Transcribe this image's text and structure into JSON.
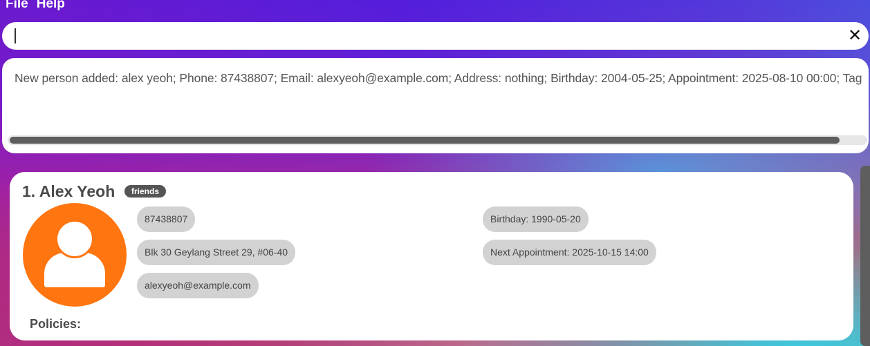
{
  "menu": {
    "file": "File",
    "help": "Help"
  },
  "command": {
    "value": "",
    "clear_icon": "close-icon"
  },
  "result": {
    "message": "New person added: alex yeoh; Phone: 87438807; Email: alexyeoh@example.com; Address: nothing; Birthday: 2004-05-25; Appointment: 2025-08-10 00:00; Tag"
  },
  "person": {
    "name": "1. Alex Yeoh",
    "tag": "friends",
    "phone": "87438807",
    "address": "Blk 30 Geylang Street 29, #06-40",
    "email": "alexyeoh@example.com",
    "birthday": "Birthday: 1990-05-20",
    "appointment": "Next Appointment: 2025-10-15 14:00",
    "policies_label": "Policies:",
    "avatar_color": "#ff7510"
  },
  "colors": {
    "pill_bg": "#d2d2d2",
    "tag_bg": "#555555",
    "scroll_thumb": "#5e5e5e"
  }
}
